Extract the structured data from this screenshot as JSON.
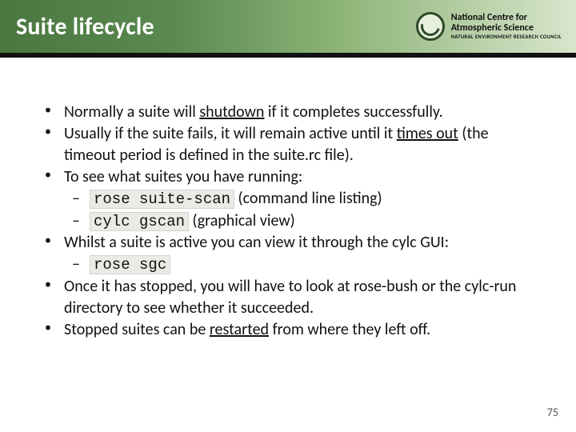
{
  "header": {
    "title": "Suite lifecycle",
    "org": {
      "line1": "National Centre for",
      "line2": "Atmospheric Science",
      "line3": "NATURAL ENVIRONMENT RESEARCH COUNCIL"
    }
  },
  "bullets": {
    "b1a": "Normally a suite will ",
    "b1u": "shutdown",
    "b1b": " if it completes successfully.",
    "b2a": "Usually if the suite fails, it will remain active until it ",
    "b2u": "times out",
    "b2b": " (the timeout period is defined in the suite.rc file).",
    "b3": "To see what suites you have running:",
    "b3s1code": "rose suite-scan",
    "b3s1rest": " (command line listing)",
    "b3s2code": "cylc gscan",
    "b3s2rest": " (graphical view)",
    "b4": "Whilst a suite is active you can view it through the cylc GUI:",
    "b4s1code": "rose sgc",
    "b5": "Once it has stopped, you will have to look at rose-bush or the cylc-run directory to see whether it succeeded.",
    "b6a": "Stopped suites can be ",
    "b6u": "restarted",
    "b6b": " from where they left off."
  },
  "page": "75"
}
